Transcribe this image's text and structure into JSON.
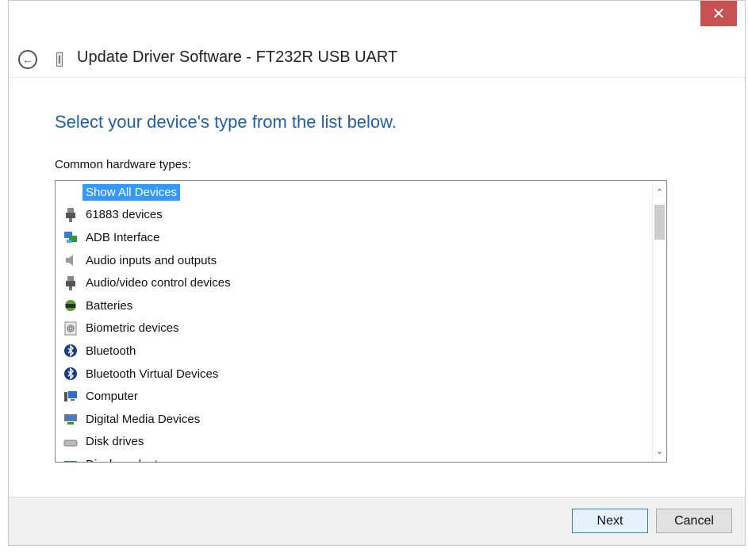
{
  "window": {
    "title": "Update Driver Software - FT232R USB UART",
    "close_symbol": "✕"
  },
  "content": {
    "heading": "Select your device's type from the list below.",
    "list_label": "Common hardware types:"
  },
  "device_list": {
    "items": [
      {
        "label": "Show All Devices",
        "icon": "none",
        "selected": true
      },
      {
        "label": "61883 devices",
        "icon": "usb-plug-icon"
      },
      {
        "label": "ADB Interface",
        "icon": "network-device-icon"
      },
      {
        "label": "Audio inputs and outputs",
        "icon": "speaker-icon"
      },
      {
        "label": "Audio/video control devices",
        "icon": "usb-plug-icon"
      },
      {
        "label": "Batteries",
        "icon": "battery-icon"
      },
      {
        "label": "Biometric devices",
        "icon": "fingerprint-icon"
      },
      {
        "label": "Bluetooth",
        "icon": "bluetooth-icon"
      },
      {
        "label": "Bluetooth Virtual Devices",
        "icon": "bluetooth-icon"
      },
      {
        "label": "Computer",
        "icon": "computer-icon"
      },
      {
        "label": "Digital Media Devices",
        "icon": "media-device-icon"
      },
      {
        "label": "Disk drives",
        "icon": "disk-drive-icon"
      },
      {
        "label": "Display adapters",
        "icon": "display-adapter-icon"
      }
    ]
  },
  "buttons": {
    "next": "Next",
    "cancel": "Cancel"
  },
  "colors": {
    "heading": "#1f5fa8",
    "selection": "#3399ff",
    "close": "#c75050"
  }
}
